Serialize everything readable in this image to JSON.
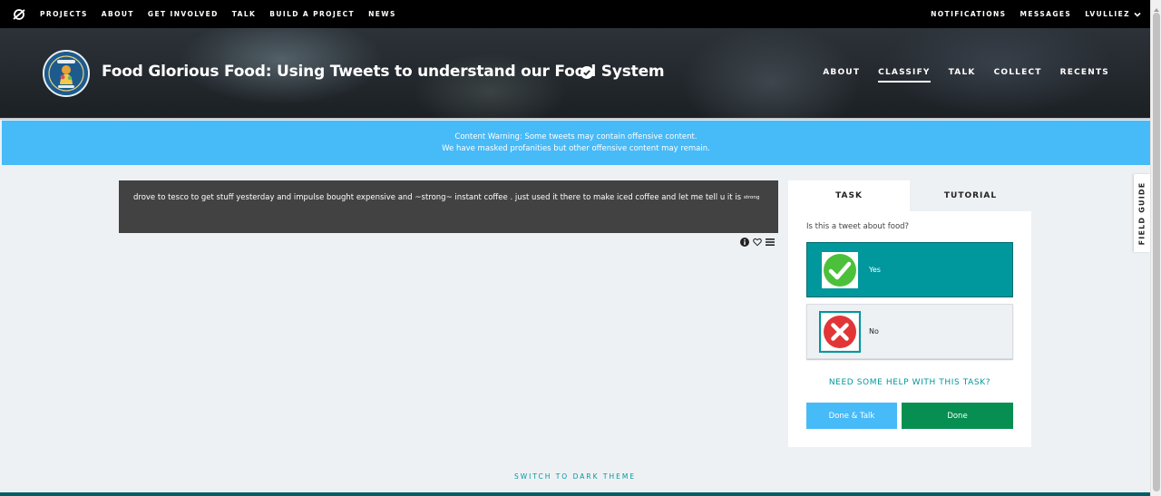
{
  "topnav": {
    "links": [
      "PROJECTS",
      "ABOUT",
      "GET INVOLVED",
      "TALK",
      "BUILD A PROJECT",
      "NEWS"
    ],
    "right": [
      "NOTIFICATIONS",
      "MESSAGES",
      "LVULLIEZ"
    ]
  },
  "project": {
    "title": "Food Glorious Food: Using Tweets to understand our Food System",
    "nav": [
      "ABOUT",
      "CLASSIFY",
      "TALK",
      "COLLECT",
      "RECENTS"
    ],
    "active_nav": "CLASSIFY"
  },
  "warning": {
    "line1": "Content Warning: Some tweets may contain offensive content.",
    "line2": "We have masked profanities but other offensive content may remain."
  },
  "tweet": {
    "text": "drove to tesco to get stuff yesterday and impulse bought expensive and ~strong~ instant coffee . just used it there to make iced coffee and let me tell u it is",
    "superscript": "strong"
  },
  "task": {
    "tabs": [
      "TASK",
      "TUTORIAL"
    ],
    "question": "Is this a tweet about food?",
    "answers": [
      {
        "label": "Yes",
        "icon": "check-icon"
      },
      {
        "label": "No",
        "icon": "x-icon"
      }
    ],
    "help": "NEED SOME HELP WITH THIS TASK?",
    "done_talk": "Done & Talk",
    "done": "Done"
  },
  "field_guide": "FIELD GUIDE",
  "switch_theme": "SWITCH TO DARK THEME",
  "colors": {
    "teal": "#00979d",
    "blue": "#47baf8",
    "green": "#078f52"
  }
}
